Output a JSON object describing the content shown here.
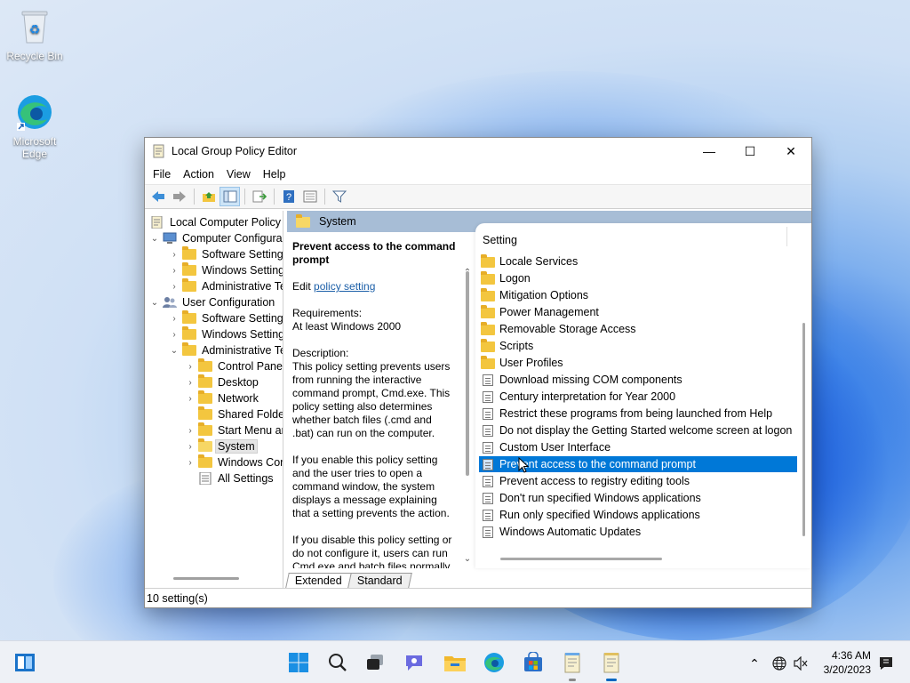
{
  "desktop": {
    "icons": [
      {
        "label": "Recycle Bin",
        "icon": "recycle-bin-icon"
      },
      {
        "label": "Microsoft Edge",
        "icon": "edge-icon"
      }
    ]
  },
  "window": {
    "title": "Local Group Policy Editor",
    "controls": {
      "minimize": "—",
      "maximize": "☐",
      "close": "✕"
    },
    "menu": [
      "File",
      "Action",
      "View",
      "Help"
    ],
    "toolbar_icons": [
      "back-arrow-icon",
      "forward-arrow-icon",
      "up-folder-icon",
      "show-hide-tree-icon",
      "export-list-icon",
      "help-icon",
      "properties-icon",
      "filter-icon"
    ]
  },
  "tree": {
    "items": [
      {
        "label": "Local Computer Policy",
        "level": 0,
        "expander": "",
        "icon": "computer-policy-icon"
      },
      {
        "label": "Computer Configura",
        "level": 0,
        "expander": "⌄",
        "icon": "computer-icon"
      },
      {
        "label": "Software Settings",
        "level": 1,
        "expander": "›",
        "icon": "folder-icon"
      },
      {
        "label": "Windows Setting",
        "level": 1,
        "expander": "›",
        "icon": "folder-icon"
      },
      {
        "label": "Administrative Te",
        "level": 1,
        "expander": "›",
        "icon": "folder-icon"
      },
      {
        "label": "User Configuration",
        "level": 0,
        "expander": "⌄",
        "icon": "users-icon"
      },
      {
        "label": "Software Settings",
        "level": 1,
        "expander": "›",
        "icon": "folder-icon"
      },
      {
        "label": "Windows Setting",
        "level": 1,
        "expander": "›",
        "icon": "folder-icon"
      },
      {
        "label": "Administrative Te",
        "level": 1,
        "expander": "⌄",
        "icon": "folder-icon"
      },
      {
        "label": "Control Panel",
        "level": 2,
        "expander": "›",
        "icon": "folder-icon"
      },
      {
        "label": "Desktop",
        "level": 2,
        "expander": "›",
        "icon": "folder-icon"
      },
      {
        "label": "Network",
        "level": 2,
        "expander": "›",
        "icon": "folder-icon"
      },
      {
        "label": "Shared Folder",
        "level": 2,
        "expander": "",
        "icon": "folder-icon"
      },
      {
        "label": "Start Menu ar",
        "level": 2,
        "expander": "›",
        "icon": "folder-icon"
      },
      {
        "label": "System",
        "level": 2,
        "expander": "›",
        "icon": "folder-icon",
        "selected": true
      },
      {
        "label": "Windows Cor",
        "level": 2,
        "expander": "›",
        "icon": "folder-icon"
      },
      {
        "label": "All Settings",
        "level": 2,
        "expander": "",
        "icon": "all-settings-icon"
      }
    ]
  },
  "pane": {
    "header": "System",
    "description": {
      "title": "Prevent access to the command prompt",
      "edit_prefix": "Edit ",
      "edit_link": "policy setting ",
      "requirements_label": "Requirements:",
      "requirements_value": "At least Windows 2000",
      "description_label": "Description:",
      "para1": "This policy setting prevents users from running the interactive command prompt, Cmd.exe.  This policy setting also determines whether batch files (.cmd and .bat) can run on the computer.",
      "para2": "If you enable this policy setting and the user tries to open a command window, the system displays a message explaining that a setting prevents the action.",
      "para3": "If you disable this policy setting or do not configure it, users can run Cmd.exe and batch files normally."
    },
    "list_header": "Setting",
    "items": [
      {
        "label": "Locale Services",
        "type": "folder"
      },
      {
        "label": "Logon",
        "type": "folder"
      },
      {
        "label": "Mitigation Options",
        "type": "folder"
      },
      {
        "label": "Power Management",
        "type": "folder"
      },
      {
        "label": "Removable Storage Access",
        "type": "folder"
      },
      {
        "label": "Scripts",
        "type": "folder"
      },
      {
        "label": "User Profiles",
        "type": "folder"
      },
      {
        "label": "Download missing COM components",
        "type": "policy"
      },
      {
        "label": "Century interpretation for Year 2000",
        "type": "policy"
      },
      {
        "label": "Restrict these programs from being launched from Help",
        "type": "policy"
      },
      {
        "label": "Do not display the Getting Started welcome screen at logon",
        "type": "policy"
      },
      {
        "label": "Custom User Interface",
        "type": "policy"
      },
      {
        "label": "Prevent access to the command prompt",
        "type": "policy",
        "selected": true
      },
      {
        "label": "Prevent access to registry editing tools",
        "type": "policy"
      },
      {
        "label": "Don't run specified Windows applications",
        "type": "policy"
      },
      {
        "label": "Run only specified Windows applications",
        "type": "policy"
      },
      {
        "label": "Windows Automatic Updates",
        "type": "policy"
      }
    ],
    "tabs": [
      "Extended",
      "Standard"
    ]
  },
  "status": "10 setting(s)",
  "taskbar": {
    "icons": [
      "widgets-icon",
      "start-icon",
      "search-icon",
      "task-view-icon",
      "chat-icon",
      "file-explorer-icon",
      "edge-icon",
      "store-icon",
      "notepad-icon",
      "group-policy-editor-icon"
    ],
    "tray_icons": [
      "show-hidden-icons-chevron-icon",
      "network-globe-icon",
      "volume-muted-icon",
      "notification-icon"
    ],
    "time": "4:36 AM",
    "date": "3/20/2023"
  },
  "colors": {
    "selection": "#0078d7",
    "pane_header": "#a7bdd6",
    "link": "#1c5fa8",
    "folder": "#f3c63f"
  }
}
